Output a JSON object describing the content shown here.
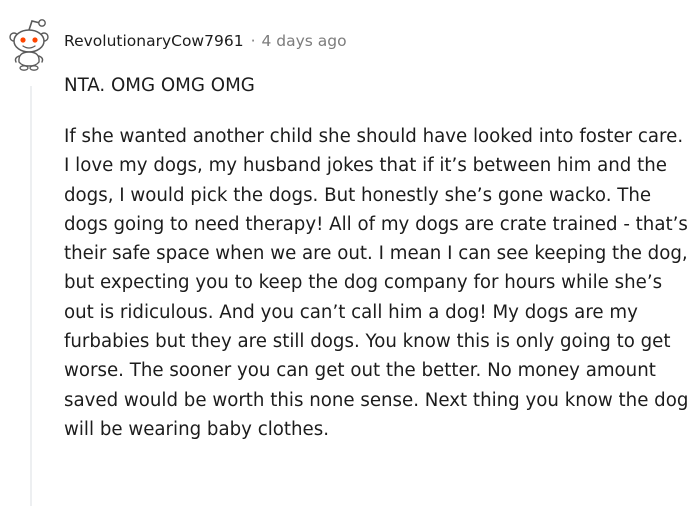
{
  "comment": {
    "username": "RevolutionaryCow7961",
    "separator": "·",
    "timestamp": "4 days ago",
    "avatar_icon": "snoo-avatar-icon",
    "paragraphs": [
      "NTA. OMG OMG OMG",
      "If she wanted another child she should have looked into foster care. I love my dogs, my husband jokes that if it’s between him and the dogs, I would pick the dogs. But honestly she’s gone wacko. The dogs going to need therapy! All of my dogs are crate trained - that’s their safe space when we are out. I mean I can see keeping the dog, but expecting you to keep the dog company for hours while she’s out is ridiculous. And you can’t call him a dog! My dogs are my furbabies but they are still dogs. You know this is only going to get worse. The sooner you can get out the better. No money amount saved would be worth this none sense. Next thing you know the dog will be wearing baby clothes."
    ]
  }
}
